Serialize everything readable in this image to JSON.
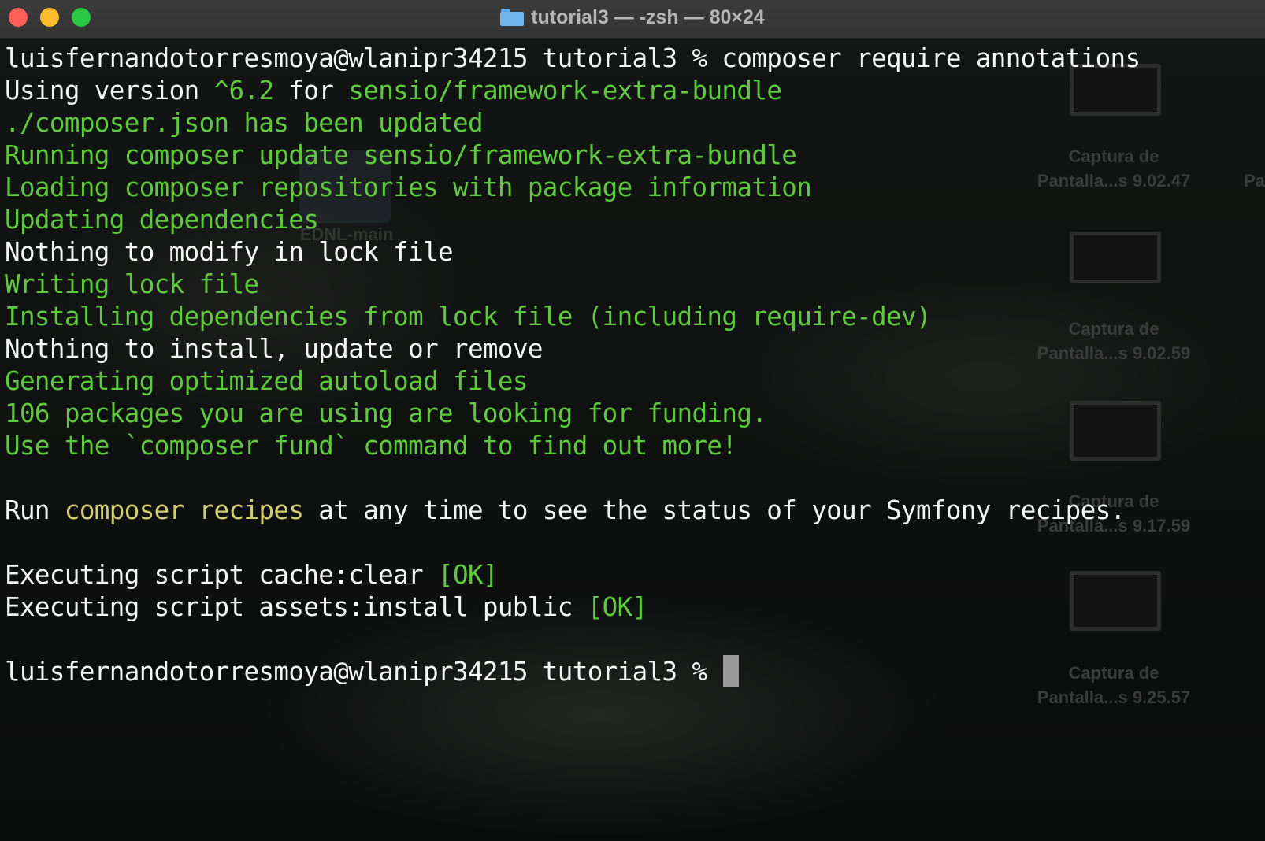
{
  "window": {
    "title": "tutorial3 — -zsh — 80×24",
    "folder_icon": "folder-icon",
    "traffic_lights": {
      "close": "#ff5f57",
      "minimize": "#febc2e",
      "zoom": "#28c840"
    }
  },
  "colors": {
    "text": "#f4f4f4",
    "green": "#5fc93d",
    "yellow": "#cfcf6e",
    "cursor": "#9a9a9a"
  },
  "desktop": {
    "folder_label": "EDNL-main",
    "screenshots": [
      {
        "line1": "Captura de",
        "line2": "Pantalla...s 9.02.47"
      },
      {
        "line1": "Captura de",
        "line2": "Pantalla...s 9.02.59"
      },
      {
        "line1": "Captura de",
        "line2": "Pantalla...s 9.17.59"
      },
      {
        "line1": "Captura de",
        "line2": "Pantalla...s 9.25.57"
      }
    ],
    "edge_label": "Pa"
  },
  "terminal": {
    "lines": [
      {
        "segments": [
          {
            "text": "luisfernandotorresmoya@wlanipr34215 tutorial3 % composer require annotations",
            "color": "white"
          }
        ]
      },
      {
        "segments": [
          {
            "text": "Using version ",
            "color": "white"
          },
          {
            "text": "^6.2",
            "color": "green"
          },
          {
            "text": " for ",
            "color": "white"
          },
          {
            "text": "sensio/framework-extra-bundle",
            "color": "green"
          }
        ]
      },
      {
        "segments": [
          {
            "text": "./composer.json has been updated",
            "color": "green"
          }
        ]
      },
      {
        "segments": [
          {
            "text": "Running composer update sensio/framework-extra-bundle",
            "color": "green"
          }
        ]
      },
      {
        "segments": [
          {
            "text": "Loading composer repositories with package information",
            "color": "green"
          }
        ]
      },
      {
        "segments": [
          {
            "text": "Updating dependencies",
            "color": "green"
          }
        ]
      },
      {
        "segments": [
          {
            "text": "Nothing to modify in lock file",
            "color": "white"
          }
        ]
      },
      {
        "segments": [
          {
            "text": "Writing lock file",
            "color": "green"
          }
        ]
      },
      {
        "segments": [
          {
            "text": "Installing dependencies from lock file (including require-dev)",
            "color": "green"
          }
        ]
      },
      {
        "segments": [
          {
            "text": "Nothing to install, update or remove",
            "color": "white"
          }
        ]
      },
      {
        "segments": [
          {
            "text": "Generating optimized autoload files",
            "color": "green"
          }
        ]
      },
      {
        "segments": [
          {
            "text": "106 packages you are using are looking for funding.",
            "color": "green"
          }
        ]
      },
      {
        "segments": [
          {
            "text": "Use the `composer fund` command to find out more!",
            "color": "green"
          }
        ]
      },
      {
        "segments": []
      },
      {
        "segments": [
          {
            "text": "Run ",
            "color": "white"
          },
          {
            "text": "composer recipes",
            "color": "yellow"
          },
          {
            "text": " at any time to see the status of your Symfony recipes.",
            "color": "white"
          }
        ]
      },
      {
        "segments": []
      },
      {
        "segments": [
          {
            "text": "Executing script cache:clear ",
            "color": "white"
          },
          {
            "text": "[OK]",
            "color": "green"
          }
        ]
      },
      {
        "segments": [
          {
            "text": "Executing script assets:install public ",
            "color": "white"
          },
          {
            "text": "[OK]",
            "color": "green"
          }
        ]
      },
      {
        "segments": []
      },
      {
        "segments": [
          {
            "text": "luisfernandotorresmoya@wlanipr34215 tutorial3 % ",
            "color": "white"
          }
        ],
        "cursor": true
      }
    ]
  }
}
